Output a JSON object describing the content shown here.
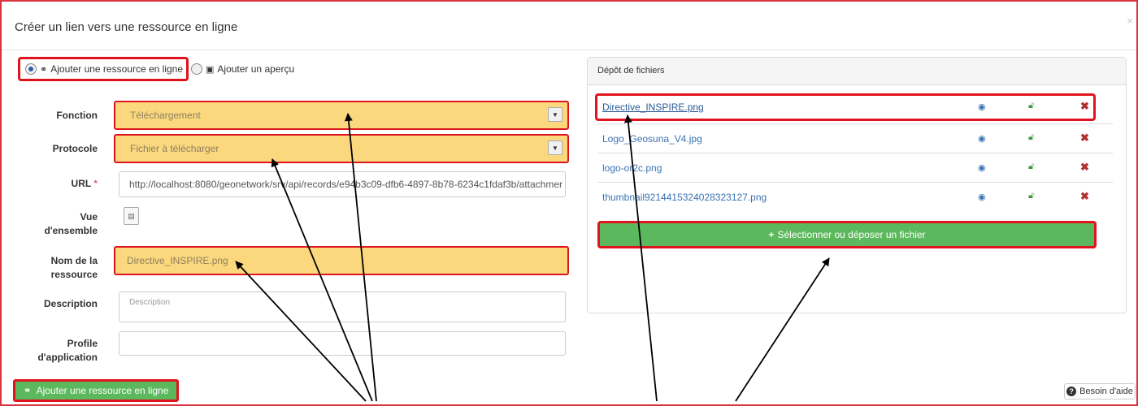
{
  "dialog": {
    "title": "Créer un lien vers une ressource en ligne",
    "close": "×"
  },
  "mode": {
    "option1": "Ajouter une ressource en ligne",
    "option2": "Ajouter un aperçu",
    "icon1": "link-icon",
    "icon2": "picture-icon"
  },
  "form": {
    "fonction": {
      "label": "Fonction",
      "value": "Téléchargement"
    },
    "protocole": {
      "label": "Protocole",
      "value": "Fichier à télécharger"
    },
    "url": {
      "label": "URL",
      "required_mark": "*",
      "value": "http://localhost:8080/geonetwork/srv/api/records/e94b3c09-dfb6-4897-8b78-6234c1fdaf3b/attachmer"
    },
    "overview": {
      "label_line1": "Vue",
      "label_line2": "d'ensemble"
    },
    "name": {
      "label_line1": "Nom de la",
      "label_line2": "ressource",
      "value": "Directive_INSPIRE.png"
    },
    "description": {
      "label": "Description",
      "placeholder": "Description"
    },
    "profile": {
      "label_line1": "Profile",
      "label_line2": "d'application",
      "value": ""
    },
    "submit_label": "Ajouter une ressource en ligne"
  },
  "files": {
    "heading": "Dépôt de fichiers",
    "items": [
      {
        "name": "Directive_INSPIRE.png"
      },
      {
        "name": "Logo_Geosuna_V4.jpg"
      },
      {
        "name": "logo-or2c.png"
      },
      {
        "name": "thumbnail9214415324028323127.png"
      }
    ],
    "icons": {
      "view": "eye-icon",
      "lock": "unlock-icon",
      "delete": "remove-icon"
    },
    "upload_label": "Sélectionner ou déposer un fichier"
  },
  "help": {
    "label": "Besoin d'aide"
  },
  "colors": {
    "highlight_border": "#e0141e",
    "highlight_fill": "#fbd87d",
    "success": "#5cb85c",
    "link": "#3a72b2"
  }
}
